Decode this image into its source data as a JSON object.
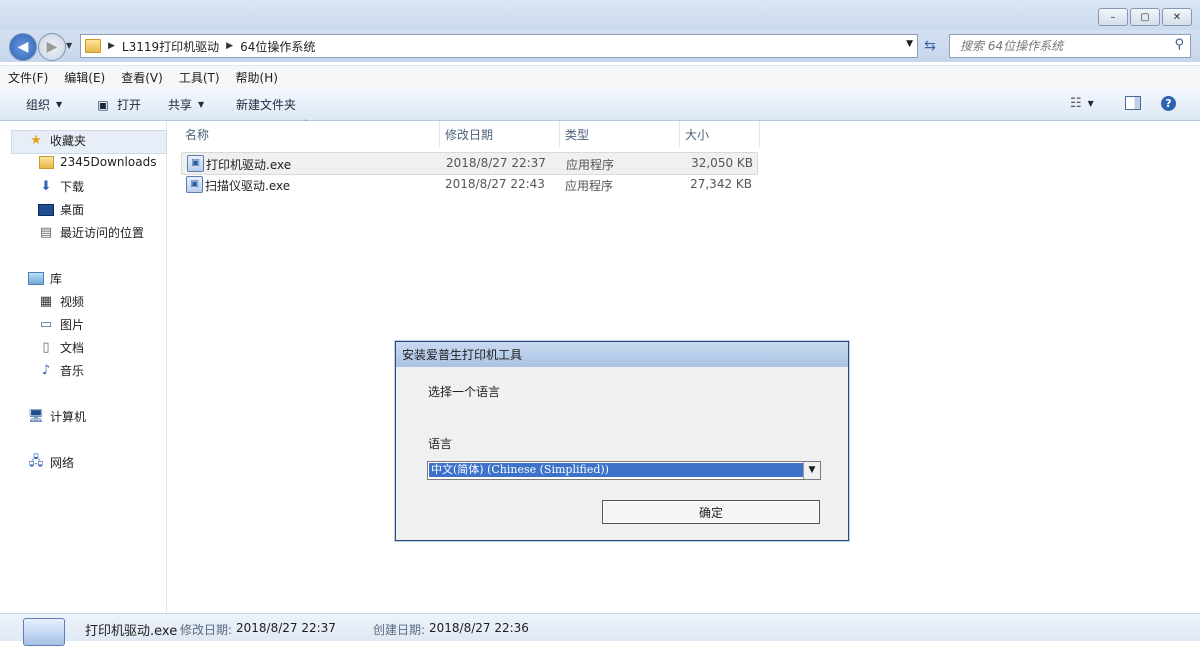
{
  "window": {
    "controls": [
      "–",
      "▢",
      "✕"
    ]
  },
  "address": {
    "crumbs": [
      "L3119打印机驱动",
      "64位操作系统"
    ],
    "search_placeholder": "搜索 64位操作系统"
  },
  "menu": [
    "文件(F)",
    "编辑(E)",
    "查看(V)",
    "工具(T)",
    "帮助(H)"
  ],
  "toolbar": {
    "organize": "组织",
    "open": "打开",
    "share": "共享",
    "new_folder": "新建文件夹"
  },
  "nav": {
    "favorites": "收藏夹",
    "fav_items": [
      "2345Downloads",
      "下载",
      "桌面",
      "最近访问的位置"
    ],
    "libraries": "库",
    "lib_items": [
      "视频",
      "图片",
      "文档",
      "音乐"
    ],
    "computer": "计算机",
    "network": "网络"
  },
  "columns": {
    "name": "名称",
    "modified": "修改日期",
    "type": "类型",
    "size": "大小"
  },
  "files": [
    {
      "name": "打印机驱动.exe",
      "modified": "2018/8/27 22:37",
      "type": "应用程序",
      "size": "32,050 KB"
    },
    {
      "name": "扫描仪驱动.exe",
      "modified": "2018/8/27 22:43",
      "type": "应用程序",
      "size": "27,342 KB"
    }
  ],
  "dialog": {
    "title": "安装爱普生打印机工具",
    "prompt": "选择一个语言",
    "language_label": "语言",
    "selected_language": "中文(简体) (Chinese (Simplified))",
    "ok_label": "确定"
  },
  "status": {
    "filename": "打印机驱动.exe",
    "modified_label": "修改日期:",
    "modified_value": "2018/8/27 22:37",
    "created_label": "创建日期:",
    "created_value": "2018/8/27 22:36"
  }
}
